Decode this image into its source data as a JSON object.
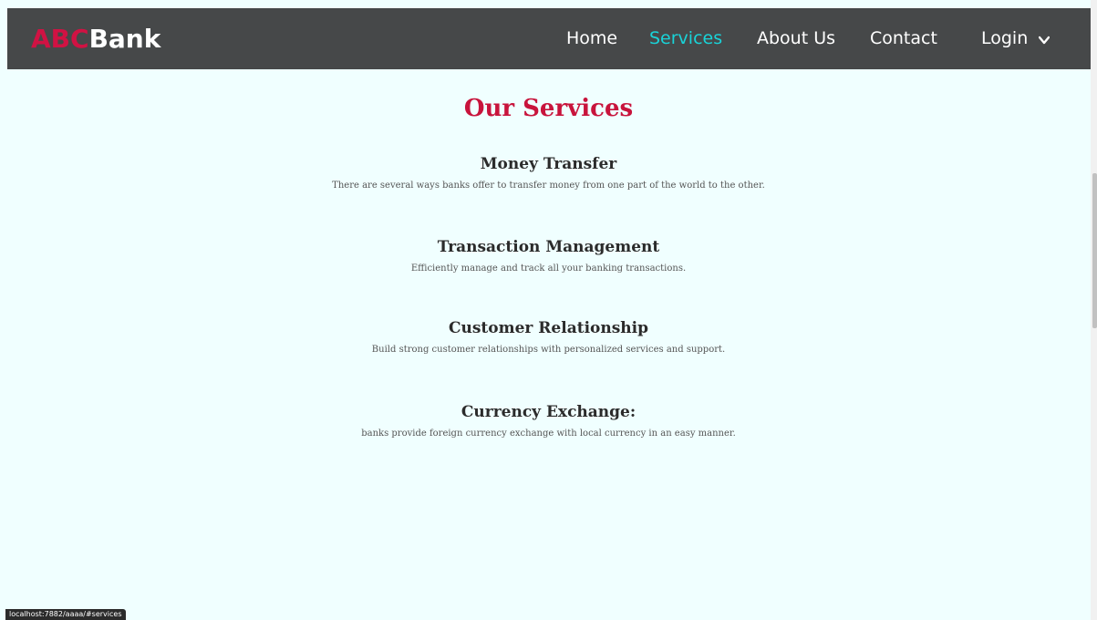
{
  "navbar": {
    "brand_accent": "ABC",
    "brand_main": "Bank",
    "links": [
      {
        "label": "Home",
        "active": false
      },
      {
        "label": "Services",
        "active": true
      },
      {
        "label": "About Us",
        "active": false
      },
      {
        "label": "Contact",
        "active": false
      },
      {
        "label": "Login",
        "active": false
      }
    ],
    "login_icon": "chevron-down-icon"
  },
  "main": {
    "title": "Our Services",
    "services": [
      {
        "title": "Money Transfer",
        "description": "There are several ways banks offer to transfer money from one part of the world to the other."
      },
      {
        "title": "Transaction Management",
        "description": "Efficiently manage and track all your banking transactions."
      },
      {
        "title": "Customer Relationship",
        "description": "Build strong customer relationships with personalized services and support."
      },
      {
        "title": "Currency Exchange:",
        "description": "banks provide foreign currency exchange with local currency in an easy manner."
      }
    ]
  },
  "status_bar": {
    "url": "localhost:7882/aaaa/#services"
  },
  "colors": {
    "navbar_bg": "#464849",
    "brand_accent": "#d11243",
    "active_link": "#19d3d8",
    "title": "#c8143c",
    "page_bg": "#f0ffff"
  }
}
